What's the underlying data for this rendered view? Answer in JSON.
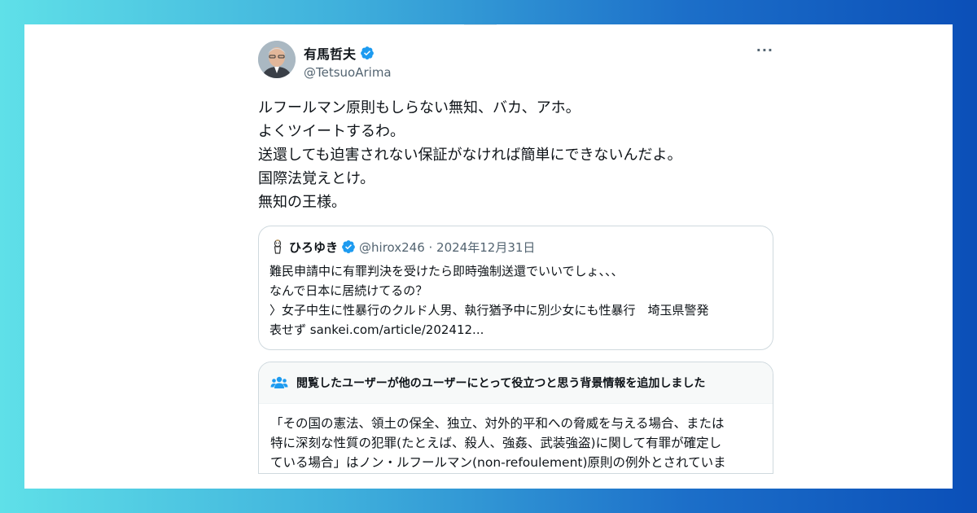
{
  "tweet": {
    "author_name": "有馬哲夫",
    "author_handle": "@TetsuoArima",
    "more_label": "···",
    "lines": [
      "ルフールマン原則もしらない無知、バカ、アホ。",
      "よくツイートするわ。",
      "送還しても迫害されない保証がなければ簡単にできないんだよ。",
      "国際法覚えとけ。",
      "無知の王様。"
    ]
  },
  "quote": {
    "author_name": "ひろゆき",
    "meta": "@hirox246 · 2024年12月31日",
    "lines": [
      "難民申請中に有罪判決を受けたら即時強制送還でいいでしょ、、、",
      "なんで日本に居続けてるの？",
      "〉女子中生に性暴行のクルド人男、執行猶予中に別少女にも性暴行　埼玉県警発",
      "表せず sankei.com/article/202412..."
    ]
  },
  "community_note": {
    "title": "閲覧したユーザーが他のユーザーにとって役立つと思う背景情報を追加しました",
    "lines": [
      "「その国の憲法、領土の保全、独立、対外的平和への脅威を与える場合、または",
      "特に深刻な性質の犯罪(たとえば、殺人、強姦、武装強盗)に関して有罪が確定し",
      "ている場合」はノン・ルフールマン(non-refoulement)原則の例外とされていま"
    ]
  },
  "colors": {
    "verified_blue": "#1d9bf0",
    "text_primary": "#0f1419",
    "text_secondary": "#536471",
    "border": "#cfd9de"
  },
  "icons": {
    "verified": "verified-badge-icon",
    "more": "more-options-icon",
    "note": "community-notes-icon"
  }
}
